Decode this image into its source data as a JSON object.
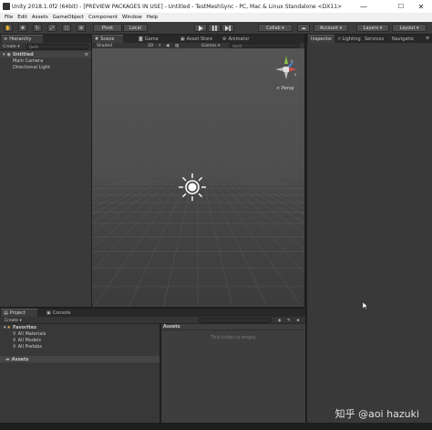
{
  "window": {
    "title": "Unity 2018.1.0f2 (64bit) - [PREVIEW PACKAGES IN USE] - Untitled - TestMeshSync - PC, Mac & Linux Standalone <DX11>",
    "minimize": "—",
    "maximize": "☐",
    "close": "✕"
  },
  "menu": [
    "File",
    "Edit",
    "Assets",
    "GameObject",
    "Component",
    "Window",
    "Help"
  ],
  "toolbar": {
    "pivot": "Pivot",
    "local": "Local",
    "play_icon": "play-icon",
    "collab": "Collab ▾",
    "account": "Account ▾",
    "layers": "Layers ▾",
    "layout": "Layout ▾"
  },
  "hierarchy": {
    "tab": "Hierarchy",
    "create": "Create ▾",
    "search_placeholder": "Q▾All",
    "scene": "Untitled",
    "items": [
      "Main Camera",
      "Directional Light"
    ]
  },
  "center_tabs": {
    "scene": "Scene",
    "game": "Game",
    "asset_store": "Asset Store",
    "animator": "Animator"
  },
  "scene_bar": {
    "shading": "Shaded",
    "mode2d": "2D",
    "gizmos": "Gizmos ▾",
    "search_placeholder": "Q▾All"
  },
  "scene_view": {
    "projection": "< Persp",
    "gizmo_x": "x",
    "gizmo_y": "y"
  },
  "right_tabs": {
    "inspector": "Inspector",
    "lighting": "Lighting",
    "services": "Services",
    "navigation": "Navigatio"
  },
  "bottom_tabs": {
    "project": "Project",
    "console": "Console"
  },
  "project": {
    "create": "Create ▾",
    "favorites": "Favorites",
    "fav_items": [
      "All Materials",
      "All Models",
      "All Prefabs"
    ],
    "assets": "Assets",
    "assets_header": "Assets",
    "empty_msg": "This folder is empty"
  },
  "watermark": "知乎 @aoi hazuki",
  "colors": {
    "window_bg": "#1e1e1e",
    "panel_bg": "#3a3a3a",
    "favorite_star": "#e2b53c",
    "sun": "#ffffff"
  }
}
